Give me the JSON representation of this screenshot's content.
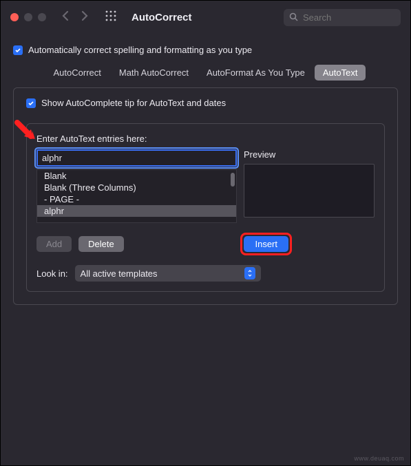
{
  "titlebar": {
    "title": "AutoCorrect",
    "search_placeholder": "Search"
  },
  "main_checkbox_label": "Automatically correct spelling and formatting as you type",
  "tabs": [
    {
      "label": "AutoCorrect"
    },
    {
      "label": "Math AutoCorrect"
    },
    {
      "label": "AutoFormat As You Type"
    },
    {
      "label": "AutoText"
    }
  ],
  "autocomplete_label": "Show AutoComplete tip for AutoText and dates",
  "entries_label": "Enter AutoText entries here:",
  "input_value": "alphr",
  "preview_label": "Preview",
  "list_items": [
    "Blank",
    "Blank (Three Columns)",
    "- PAGE -",
    "alphr"
  ],
  "buttons": {
    "add": "Add",
    "delete": "Delete",
    "insert": "Insert"
  },
  "lookin": {
    "label": "Look in:",
    "value": "All active templates"
  },
  "watermark": "www.deuaq.com"
}
